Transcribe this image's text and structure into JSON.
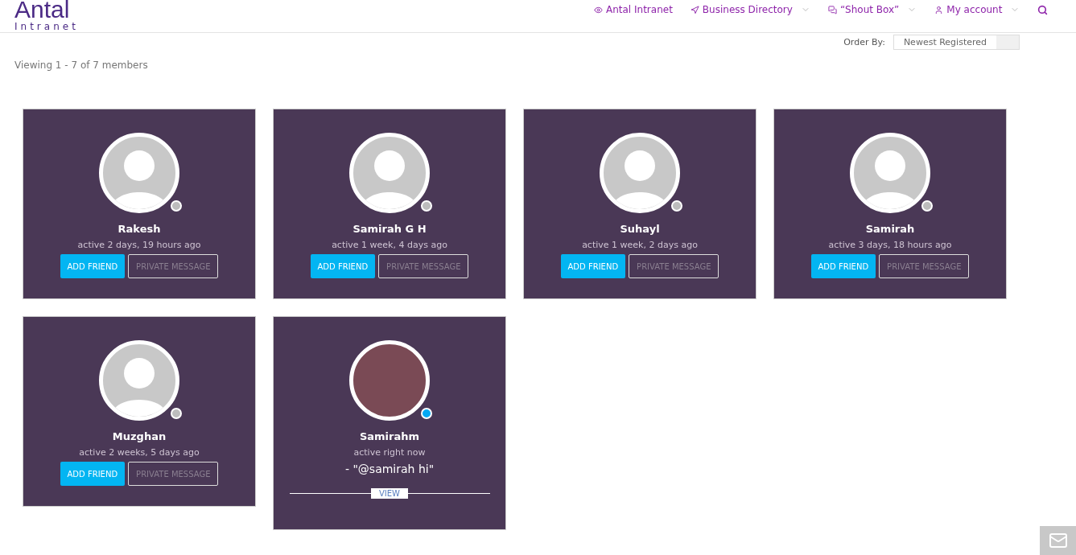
{
  "logo": {
    "title": "Antal",
    "subtitle": "Intranet"
  },
  "nav": [
    {
      "kind": "eye",
      "label": "Antal Intranet",
      "dropdown": false
    },
    {
      "kind": "arrow",
      "label": "Business Directory",
      "dropdown": true
    },
    {
      "kind": "chat",
      "label": "“Shout Box”",
      "dropdown": true
    },
    {
      "kind": "user",
      "label": "My account",
      "dropdown": true
    }
  ],
  "order_by": {
    "label": "Order By:",
    "value": "Newest Registered"
  },
  "viewing": "Viewing 1 - 7 of 7 members",
  "members": [
    {
      "name": "Rakesh",
      "activity": "active 2 days, 19 hours ago",
      "photo": false,
      "color": "#bdbdbd",
      "kind": "buttons",
      "buttons": [
        "ADD FRIEND",
        "PRIVATE MESSAGE"
      ]
    },
    {
      "name": "Samirah G H",
      "activity": "active 1 week, 4 days ago",
      "photo": false,
      "color": "#bdbdbd",
      "kind": "buttons",
      "buttons": [
        "ADD FRIEND",
        "PRIVATE MESSAGE"
      ]
    },
    {
      "name": "Suhayl",
      "activity": "active 1 week, 2 days ago",
      "photo": false,
      "color": "#bdbdbd",
      "kind": "buttons",
      "buttons": [
        "ADD FRIEND",
        "PRIVATE MESSAGE"
      ]
    },
    {
      "name": "Samirah",
      "activity": "active 3 days, 18 hours ago",
      "photo": false,
      "color": "#bdbdbd",
      "kind": "buttons",
      "buttons": [
        "ADD FRIEND",
        "PRIVATE MESSAGE"
      ]
    },
    {
      "name": "Muzghan",
      "activity": "active 2 weeks, 5 days ago",
      "photo": false,
      "color": "#bdbdbd",
      "kind": "buttons",
      "buttons": [
        "ADD FRIEND",
        "PRIVATE MESSAGE"
      ]
    },
    {
      "name": "Samirahm",
      "activity": "active right now",
      "photo": true,
      "color": "#03a9f4",
      "kind": "update",
      "update": "- \"@samirah hi\"",
      "view": "VIEW"
    }
  ]
}
